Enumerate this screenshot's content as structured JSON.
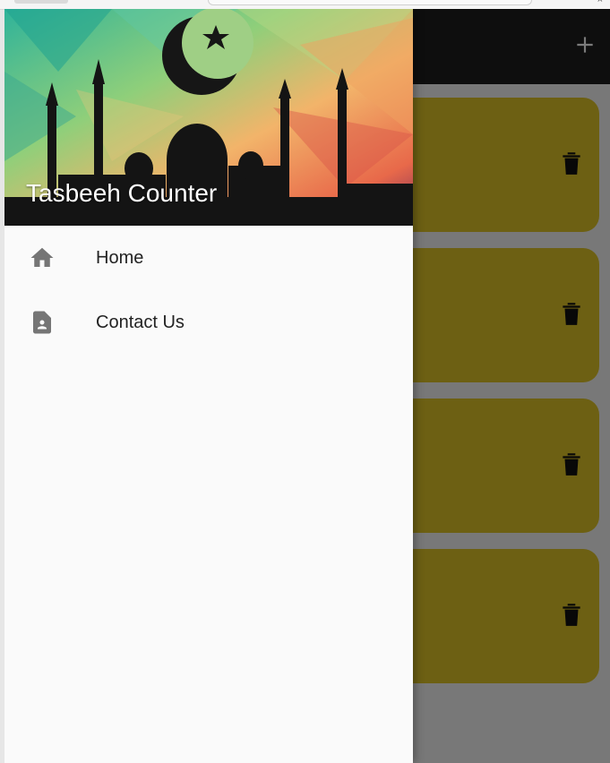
{
  "drawer": {
    "title": "Tasbeeh Counter",
    "items": [
      {
        "label": "Home",
        "icon": "home-icon"
      },
      {
        "label": "Contact Us",
        "icon": "contact-page-icon"
      }
    ]
  },
  "appbar": {
    "action_icon": "add-icon"
  },
  "cards": [
    {
      "action_icon": "delete-icon"
    },
    {
      "action_icon": "delete-icon"
    },
    {
      "action_icon": "delete-icon"
    },
    {
      "action_icon": "delete-icon"
    }
  ],
  "colors": {
    "card": "#e3c928",
    "appbar": "#1f1f1f",
    "drawer_bg": "#fafafa",
    "scrim": "rgba(0,0,0,0.52)"
  }
}
